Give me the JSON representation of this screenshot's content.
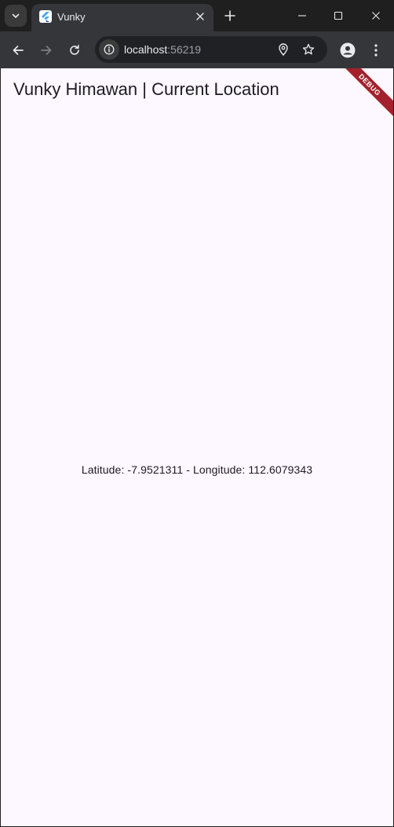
{
  "browser": {
    "tab": {
      "title": "Vunky"
    },
    "omnibox": {
      "host": "localhost",
      "port": ":56219"
    }
  },
  "app": {
    "title": "Vunky Himawan | Current Location",
    "location_text": "Latitude: -7.9521311 - Longitude: 112.6079343",
    "debug_banner": "DEBUG"
  },
  "colors": {
    "chrome_frame": "#1f1f1f",
    "toolbar": "#35363a",
    "page_background": "#fdf7ff",
    "debug_banner": "#a3212b"
  }
}
